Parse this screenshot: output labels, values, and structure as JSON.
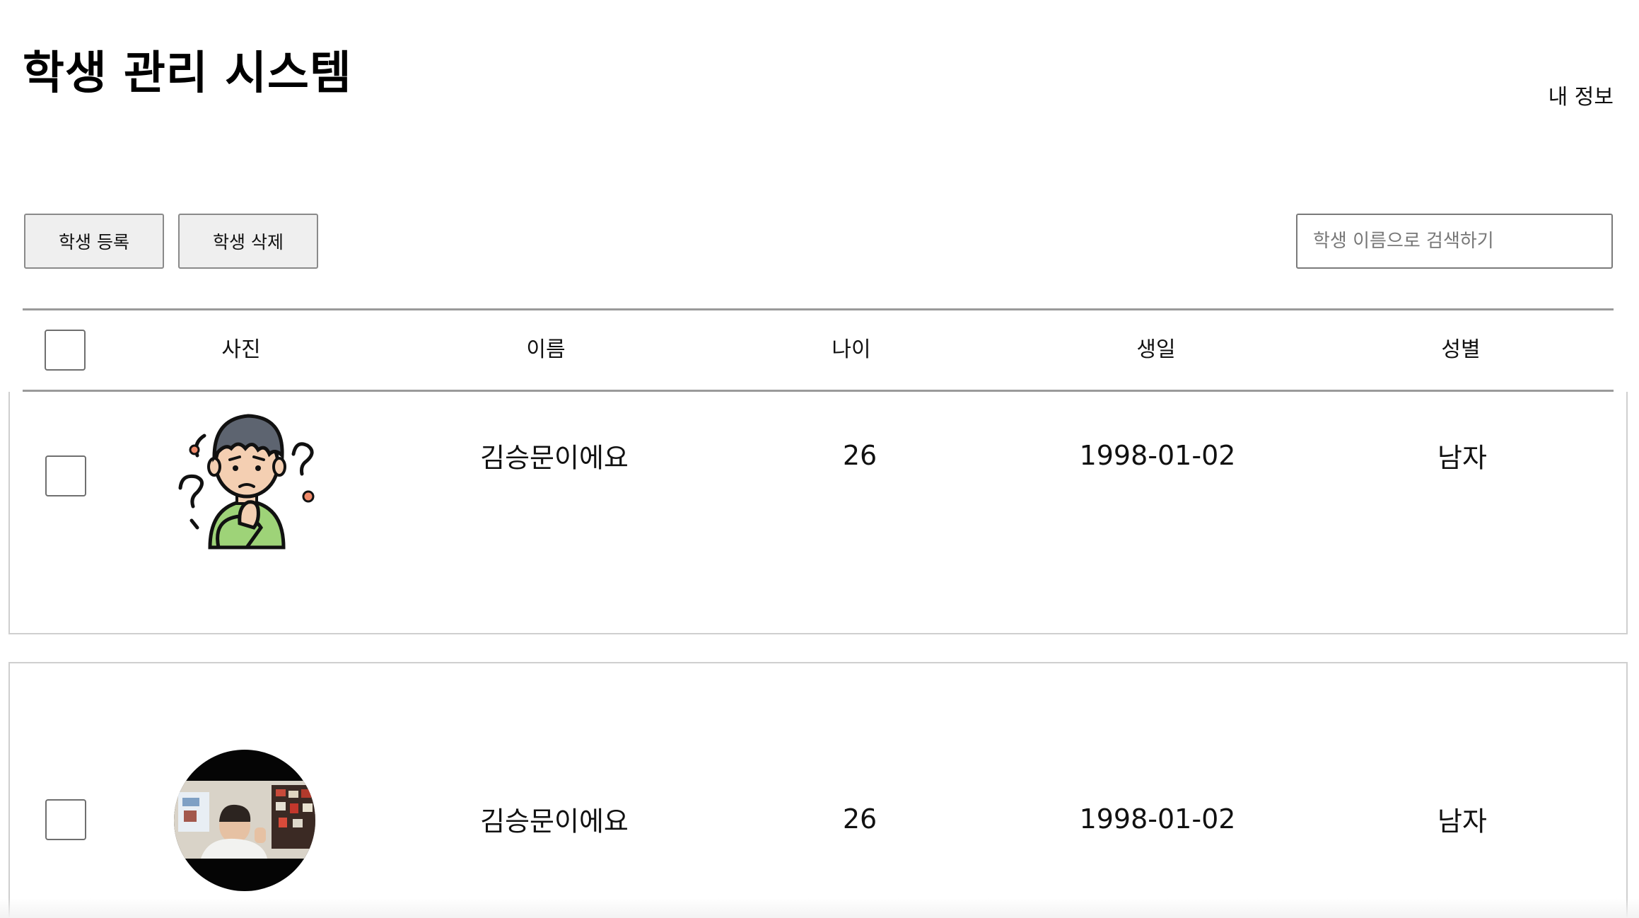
{
  "header": {
    "title": "학생 관리 시스템",
    "my_info_link": "내 정보"
  },
  "toolbar": {
    "register_label": "학생 등록",
    "delete_label": "학생 삭제",
    "search_placeholder": "학생 이름으로 검색하기",
    "search_value": ""
  },
  "table": {
    "columns": [
      "사진",
      "이름",
      "나이",
      "생일",
      "성별"
    ],
    "rows": [
      {
        "photo_icon": "confused-boy-avatar-icon",
        "name": "김승문이에요",
        "age": "26",
        "birthday": "1998-01-02",
        "gender": "남자"
      },
      {
        "photo_icon": "student-photo-thumbnail",
        "name": "김승문이에요",
        "age": "26",
        "birthday": "1998-01-02",
        "gender": "남자"
      }
    ]
  },
  "colors": {
    "border": "#9a9a9a",
    "button_bg": "#efefef",
    "avatar_shirt": "#9ed378",
    "avatar_skin": "#f4cfb2",
    "avatar_hair": "#5d6470"
  }
}
